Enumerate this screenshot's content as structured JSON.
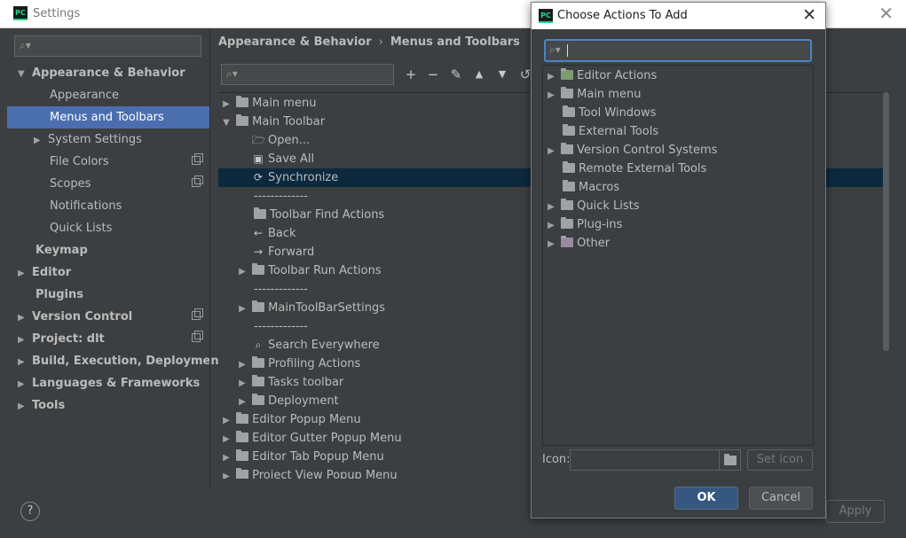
{
  "window": {
    "title": "Settings",
    "app_badge": "PC"
  },
  "sidebar": {
    "search_placeholder": "",
    "items": [
      {
        "label": "Appearance & Behavior"
      },
      {
        "label": "Appearance"
      },
      {
        "label": "Menus and Toolbars"
      },
      {
        "label": "System Settings"
      },
      {
        "label": "File Colors"
      },
      {
        "label": "Scopes"
      },
      {
        "label": "Notifications"
      },
      {
        "label": "Quick Lists"
      },
      {
        "label": "Keymap"
      },
      {
        "label": "Editor"
      },
      {
        "label": "Plugins"
      },
      {
        "label": "Version Control"
      },
      {
        "label": "Project: dlt"
      },
      {
        "label": "Build, Execution, Deployment"
      },
      {
        "label": "Languages & Frameworks"
      },
      {
        "label": "Tools"
      }
    ]
  },
  "breadcrumb": {
    "parent": "Appearance & Behavior",
    "separator": "›",
    "current": "Menus and Toolbars"
  },
  "toolbar": {
    "add": "+",
    "remove": "−",
    "edit": "✎",
    "up": "▲",
    "down": "▼",
    "restore": "↺"
  },
  "actions_tree": [
    {
      "label": "Main menu"
    },
    {
      "label": "Main Toolbar"
    },
    {
      "label": "Open..."
    },
    {
      "label": "Save All"
    },
    {
      "label": "Synchronize"
    },
    {
      "label": "-------------"
    },
    {
      "label": "Toolbar Find Actions"
    },
    {
      "label": "Back"
    },
    {
      "label": "Forward"
    },
    {
      "label": "Toolbar Run Actions"
    },
    {
      "label": "-------------"
    },
    {
      "label": "MainToolBarSettings"
    },
    {
      "label": "-------------"
    },
    {
      "label": "Search Everywhere"
    },
    {
      "label": "Profiling Actions"
    },
    {
      "label": "Tasks toolbar"
    },
    {
      "label": "Deployment"
    },
    {
      "label": "Editor Popup Menu"
    },
    {
      "label": "Editor Gutter Popup Menu"
    },
    {
      "label": "Editor Tab Popup Menu"
    },
    {
      "label": "Project View Popup Menu"
    }
  ],
  "footer": {
    "help": "?",
    "apply": "Apply"
  },
  "dialog": {
    "title": "Choose Actions To Add",
    "app_badge": "PC",
    "search_value": "",
    "tree": [
      {
        "label": "Editor Actions"
      },
      {
        "label": "Main menu"
      },
      {
        "label": "Tool Windows"
      },
      {
        "label": "External Tools"
      },
      {
        "label": "Version Control Systems"
      },
      {
        "label": "Remote External Tools"
      },
      {
        "label": "Macros"
      },
      {
        "label": "Quick Lists"
      },
      {
        "label": "Plug-ins"
      },
      {
        "label": "Other"
      }
    ],
    "icon_label": "Icon:",
    "icon_value": "",
    "set_icon": "Set icon",
    "ok": "OK",
    "cancel": "Cancel"
  }
}
